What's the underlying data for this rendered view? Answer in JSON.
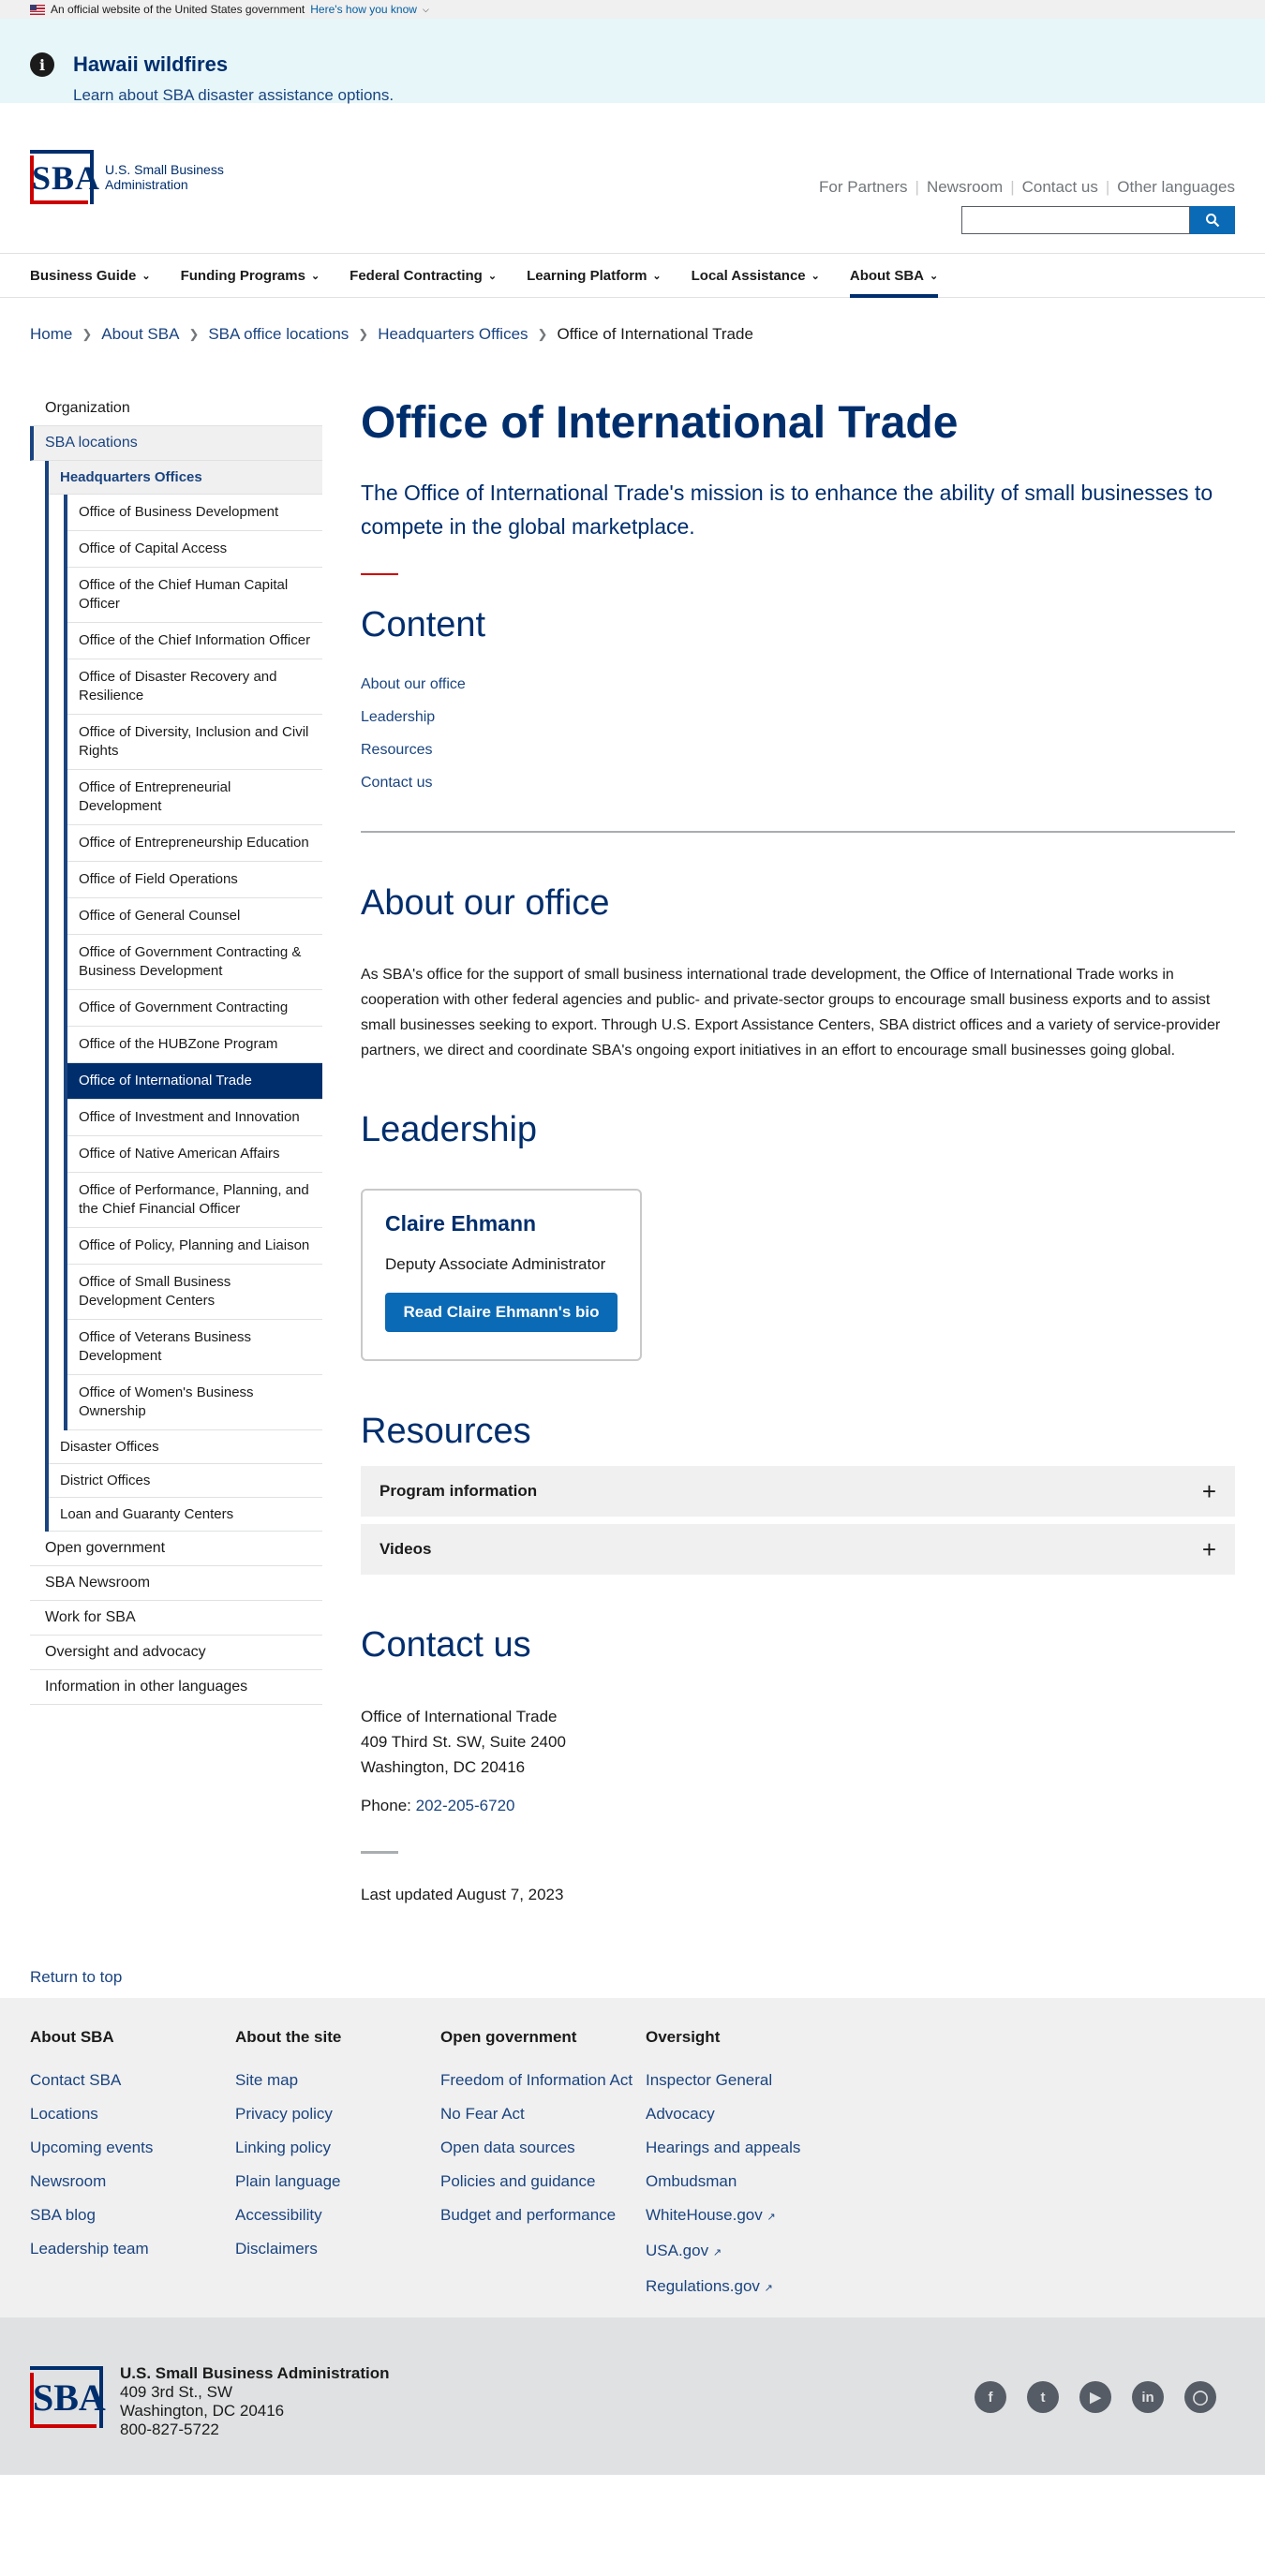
{
  "gov_banner": {
    "text": "An official website of the United States government",
    "link": "Here's how you know"
  },
  "alert": {
    "title": "Hawaii wildfires",
    "link": "Learn about SBA disaster assistance options."
  },
  "header": {
    "logo_abbr": "SBA",
    "logo_line1": "U.S. Small Business",
    "logo_line2": "Administration",
    "utility": [
      "For Partners",
      "Newsroom",
      "Contact us",
      "Other languages"
    ],
    "search_placeholder": ""
  },
  "nav": [
    "Business Guide",
    "Funding Programs",
    "Federal Contracting",
    "Learning Platform",
    "Local Assistance",
    "About SBA"
  ],
  "breadcrumbs": [
    "Home",
    "About SBA",
    "SBA office locations",
    "Headquarters Offices",
    "Office of International Trade"
  ],
  "sidebar": {
    "top": [
      "Organization",
      "SBA locations"
    ],
    "level2_current": "Headquarters Offices",
    "level3": [
      "Office of Business Development",
      "Office of Capital Access",
      "Office of the Chief Human Capital Officer",
      "Office of the Chief Information Officer",
      "Office of Disaster Recovery and Resilience",
      "Office of Diversity, Inclusion and Civil Rights",
      "Office of Entrepreneurial Development",
      "Office of Entrepreneurship Education",
      "Office of Field Operations",
      "Office of General Counsel",
      "Office of Government Contracting & Business Development",
      "Office of Government Contracting",
      "Office of the HUBZone Program",
      "Office of International Trade",
      "Office of Investment and Innovation",
      "Office of Native American Affairs",
      "Office of Performance, Planning, and the Chief Financial Officer",
      "Office of Policy, Planning and Liaison",
      "Office of Small Business Development Centers",
      "Office of Veterans Business Development",
      "Office of Women's Business Ownership"
    ],
    "level2_rest": [
      "Disaster Offices",
      "District Offices",
      "Loan and Guaranty Centers"
    ],
    "bottom": [
      "Open government",
      "SBA Newsroom",
      "Work for SBA",
      "Oversight and advocacy",
      "Information in other languages"
    ]
  },
  "page": {
    "title": "Office of International Trade",
    "lead": "The Office of International Trade's mission is to enhance the ability of small businesses to compete in the global marketplace.",
    "content_heading": "Content",
    "toc": [
      "About our office",
      "Leadership",
      "Resources",
      "Contact us"
    ],
    "about_heading": "About our office",
    "about_text": "As SBA's office for the support of small business international trade development, the Office of International Trade works in cooperation with other federal agencies and public- and private-sector groups to encourage small business exports and to assist small businesses seeking to export. Through U.S. Export Assistance Centers, SBA district offices and a variety of service-provider partners, we direct and coordinate SBA's ongoing export initiatives in an effort to encourage small businesses going global.",
    "leadership_heading": "Leadership",
    "leader": {
      "name": "Claire Ehmann",
      "role": "Deputy Associate Administrator",
      "button": "Read Claire Ehmann's bio"
    },
    "resources_heading": "Resources",
    "accordions": [
      "Program information",
      "Videos"
    ],
    "contact_heading": "Contact us",
    "address": [
      "Office of International Trade",
      "409 Third St. SW, Suite 2400",
      "Washington, DC 20416"
    ],
    "phone_label": "Phone: ",
    "phone": "202-205-6720",
    "updated": "Last updated August 7, 2023"
  },
  "return_to_top": "Return to top",
  "footer": {
    "columns": [
      {
        "title": "About SBA",
        "links": [
          "Contact SBA",
          "Locations",
          "Upcoming events",
          "Newsroom",
          "SBA blog",
          "Leadership team"
        ]
      },
      {
        "title": "About the site",
        "links": [
          "Site map",
          "Privacy policy",
          "Linking policy",
          "Plain language",
          "Accessibility",
          "Disclaimers"
        ]
      },
      {
        "title": "Open government",
        "links": [
          "Freedom of Information Act",
          "No Fear Act",
          "Open data sources",
          "Policies and guidance",
          "Budget and performance"
        ]
      },
      {
        "title": "Oversight",
        "links": [
          "Inspector General",
          "Advocacy",
          "Hearings and appeals",
          "Ombudsman",
          "WhiteHouse.gov",
          "USA.gov",
          "Regulations.gov"
        ]
      }
    ]
  },
  "bottom_footer": {
    "name": "U.S. Small Business Administration",
    "street": "409 3rd St., SW",
    "city": "Washington, DC 20416",
    "phone": "800-827-5722",
    "social_icons": [
      "facebook-icon",
      "twitter-icon",
      "youtube-icon",
      "linkedin-icon",
      "instagram-icon"
    ]
  }
}
